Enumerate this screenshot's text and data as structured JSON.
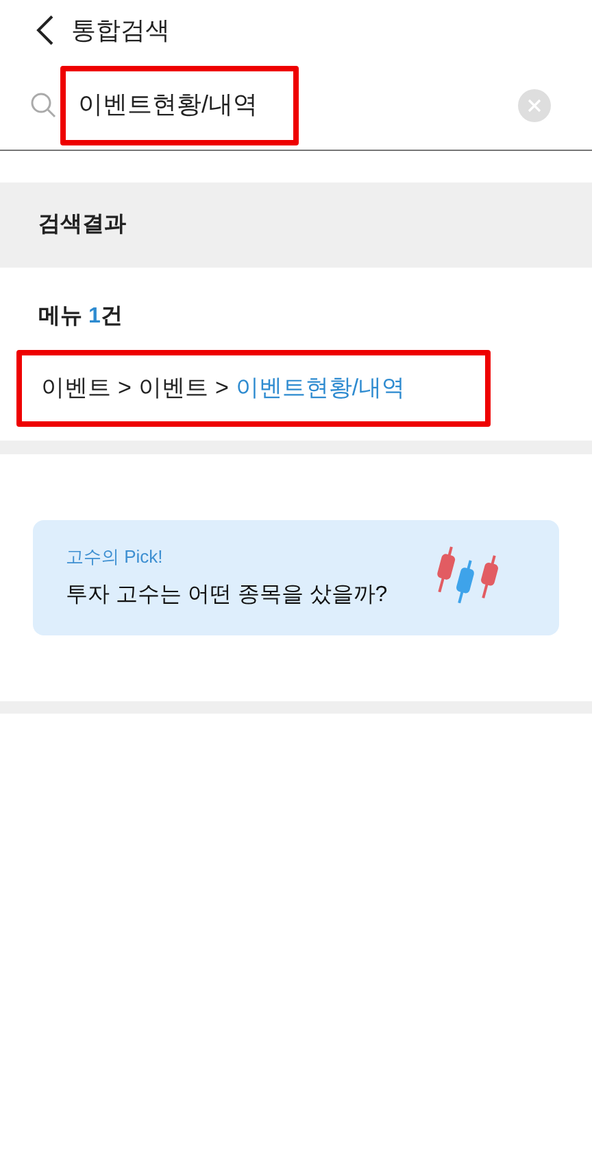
{
  "header": {
    "title": "통합검색"
  },
  "search": {
    "value": "이벤트현황/내역",
    "highlighted": true
  },
  "results": {
    "title": "검색결과",
    "menu_label": "메뉴",
    "menu_count": "1",
    "menu_unit": "건",
    "highlighted": true,
    "path": [
      {
        "text": "이벤트",
        "kind": "segment"
      },
      {
        "text": ">",
        "kind": "separator"
      },
      {
        "text": "이벤트",
        "kind": "segment"
      },
      {
        "text": ">",
        "kind": "separator"
      },
      {
        "text": "이벤트현황/내역",
        "kind": "match"
      }
    ]
  },
  "promo": {
    "tag": "고수의 Pick!",
    "text": "투자 고수는 어떤 종목을 샀을까?"
  }
}
